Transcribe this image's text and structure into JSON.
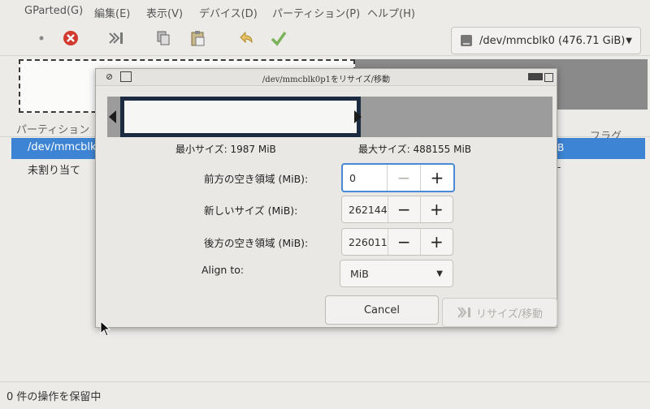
{
  "menu": [
    "GParted(G)",
    "編集(E)",
    "表示(V)",
    "デバイス(D)",
    "パーティション(P)",
    "ヘルプ(H)"
  ],
  "device": {
    "selected": "/dev/mmcblk0 (476.71 GiB)"
  },
  "list": {
    "col_partition": "パーティション",
    "col_flags": "フラグ",
    "rows": [
      {
        "name": "/dev/mmcblk0",
        "extra": "B"
      },
      {
        "name": "未割り当て",
        "extra": "-"
      }
    ]
  },
  "status": "0 件の操作を保留中",
  "dialog": {
    "title": "/dev/mmcblk0p1をリサイズ/移動",
    "min_size": "最小サイズ: 1987 MiB",
    "max_size": "最大サイズ: 488155 MiB",
    "free_before_label": "前方の空き領域 (MiB):",
    "free_before_value": "0",
    "new_size_label": "新しいサイズ (MiB):",
    "new_size_value": "262144",
    "free_after_label": "後方の空き領域 (MiB):",
    "free_after_value": "226011",
    "align_label": "Align to:",
    "align_value": "MiB",
    "cancel_label": "Cancel",
    "resize_label": "リサイズ/移動"
  },
  "colors": {
    "selection": "#3d84d4",
    "partition_border": "#1c2b40",
    "unallocated": "#9c9c9c",
    "focus": "#4a89d6"
  }
}
